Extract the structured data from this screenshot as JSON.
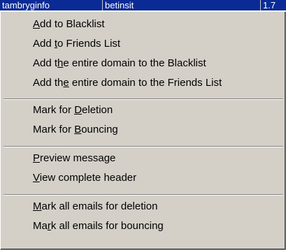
{
  "title_strip": {
    "cells": [
      "tambryginfo",
      "betinsit",
      "1.7"
    ]
  },
  "menu": {
    "items": [
      {
        "pre": "",
        "accel": "A",
        "post": "dd to Blacklist"
      },
      {
        "pre": "Add ",
        "accel": "t",
        "post": "o Friends List"
      },
      {
        "pre": "Add t",
        "accel": "h",
        "post": "e entire domain to the Blacklist"
      },
      {
        "pre": "Add th",
        "accel": "e",
        "post": " entire domain to the Friends List"
      },
      {
        "pre": "Mark for ",
        "accel": "D",
        "post": "eletion"
      },
      {
        "pre": "Mark for ",
        "accel": "B",
        "post": "ouncing"
      },
      {
        "pre": "",
        "accel": "P",
        "post": "review message"
      },
      {
        "pre": "",
        "accel": "V",
        "post": "iew complete header"
      },
      {
        "pre": "",
        "accel": "M",
        "post": "ark all emails for deletion"
      },
      {
        "pre": "Ma",
        "accel": "r",
        "post": "k all emails for bouncing"
      }
    ]
  }
}
